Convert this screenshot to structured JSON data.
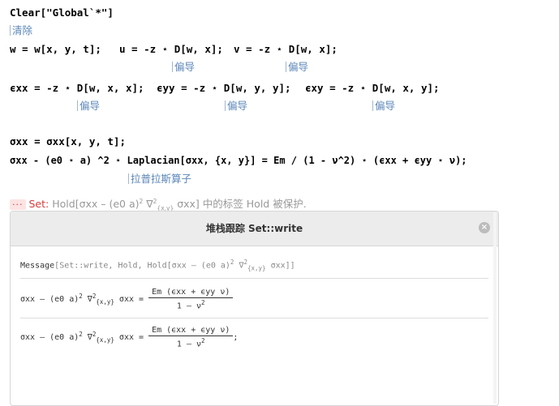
{
  "notebook": {
    "line1": "Clear[\"Global`*\"]",
    "note_clear": "清除",
    "line2_w": "w = w[x, y, t];",
    "line2_u": "u = -z ⋆ D[w, x];",
    "line2_v": "v = -z ⋆ D[w, x];",
    "note_deriv": "偏导",
    "line3_exx": "ϵxx = -z ⋆ D[w, x, x];",
    "line3_eyy": "ϵyy = -z ⋆ D[w, y, y];",
    "line3_exy": "ϵxy = -z ⋆ D[w, x, y];",
    "line4": "σxx = σxx[x, y, t];",
    "line5": "σxx - (e0 ⋆ a) ^2 ⋆ Laplacian[σxx, {x, y}] = Em / (1 - ν^2) ⋆ (ϵxx + ϵyy ⋆ ν);",
    "note_laplacian": "拉普拉斯算子"
  },
  "message": {
    "button": "···",
    "label": "Set:",
    "text_pre": "Hold[σxx – (e0 a)",
    "text_mid": " ∇",
    "text_sub": "{x,y}",
    "text_post": " σxx]",
    "text_tail": "中的标签 Hold 被保护."
  },
  "stack_trace": {
    "title": "堆栈跟踪 Set::write",
    "close_label": "×",
    "row1_head": "Message",
    "row1_body": "Set::write, Hold, Hold",
    "row1_expr": "σxx – (e0 a)",
    "row1_tail": " σxx]]",
    "lhs": "σxx – (e0 a)",
    "lhs_end": " σxx =",
    "numerator": "Em (ϵxx + ϵyy ν)",
    "denominator": "1 – ν",
    "semicolon": ";",
    "sup2": "2",
    "nabla": " ∇",
    "subxy": "{x,y}"
  }
}
